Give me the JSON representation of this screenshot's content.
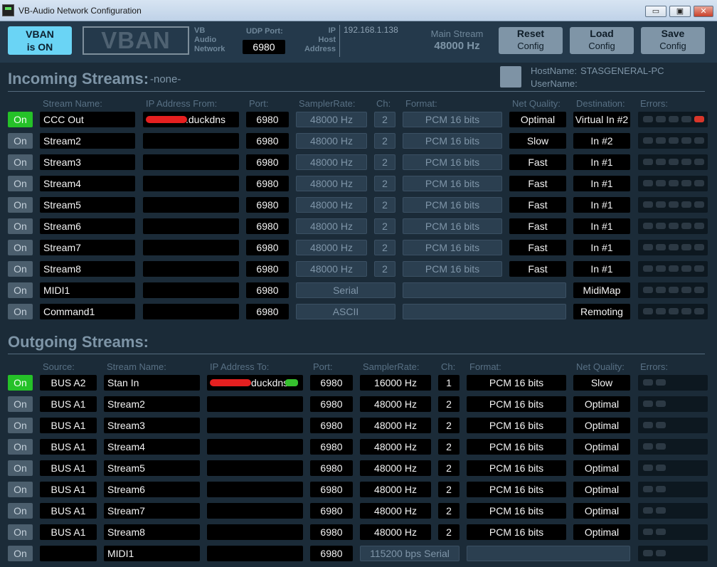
{
  "window": {
    "title": "VB-Audio Network Configuration",
    "min": "▭",
    "max": "▣",
    "close": "✕"
  },
  "header": {
    "vban_status": "VBAN\nis ON",
    "logo": "VBAN",
    "vb_small": "VB\nAudio\nNetwork",
    "udp_label": "UDP Port:",
    "udp_port": "6980",
    "ip_label": "IP\nHost\nAddress",
    "ip": "192.168.1.138",
    "main_stream_label": "Main Stream",
    "main_stream_rate": "48000 Hz",
    "reset_l1": "Reset",
    "reset_l2": "Config",
    "load_l1": "Load",
    "load_l2": "Config",
    "save_l1": "Save",
    "save_l2": "Config"
  },
  "incoming": {
    "title": "Incoming Streams:",
    "none": "-none-",
    "hostname_label": "HostName:",
    "hostname": "STASGENERAL-PC",
    "username_label": "UserName:",
    "columns": {
      "name": "Stream Name:",
      "ip": "IP Address From:",
      "port": "Port:",
      "rate": "SamplerRate:",
      "ch": "Ch:",
      "format": "Format:",
      "quality": "Net Quality:",
      "dest": "Destination:",
      "errors": "Errors:"
    },
    "on_label": "On",
    "rows": [
      {
        "active": true,
        "name": "CCC Out",
        "ip": ".duckdns",
        "port": "6980",
        "rate": "48000 Hz",
        "ch": "2",
        "format": "PCM 16 bits",
        "quality": "Optimal",
        "dest": "Virtual In #2",
        "error_led": true
      },
      {
        "active": false,
        "name": "Stream2",
        "ip": "",
        "port": "6980",
        "rate": "48000 Hz",
        "ch": "2",
        "format": "PCM 16 bits",
        "quality": "Slow",
        "dest": "In #2",
        "error_led": false
      },
      {
        "active": false,
        "name": "Stream3",
        "ip": "",
        "port": "6980",
        "rate": "48000 Hz",
        "ch": "2",
        "format": "PCM 16 bits",
        "quality": "Fast",
        "dest": "In #1",
        "error_led": false
      },
      {
        "active": false,
        "name": "Stream4",
        "ip": "",
        "port": "6980",
        "rate": "48000 Hz",
        "ch": "2",
        "format": "PCM 16 bits",
        "quality": "Fast",
        "dest": "In #1",
        "error_led": false
      },
      {
        "active": false,
        "name": "Stream5",
        "ip": "",
        "port": "6980",
        "rate": "48000 Hz",
        "ch": "2",
        "format": "PCM 16 bits",
        "quality": "Fast",
        "dest": "In #1",
        "error_led": false
      },
      {
        "active": false,
        "name": "Stream6",
        "ip": "",
        "port": "6980",
        "rate": "48000 Hz",
        "ch": "2",
        "format": "PCM 16 bits",
        "quality": "Fast",
        "dest": "In #1",
        "error_led": false
      },
      {
        "active": false,
        "name": "Stream7",
        "ip": "",
        "port": "6980",
        "rate": "48000 Hz",
        "ch": "2",
        "format": "PCM 16 bits",
        "quality": "Fast",
        "dest": "In #1",
        "error_led": false
      },
      {
        "active": false,
        "name": "Stream8",
        "ip": "",
        "port": "6980",
        "rate": "48000 Hz",
        "ch": "2",
        "format": "PCM 16 bits",
        "quality": "Fast",
        "dest": "In #1",
        "error_led": false
      },
      {
        "active": false,
        "name": "MIDI1",
        "ip": "",
        "port": "6980",
        "rate": "Serial",
        "ch": "",
        "format": "",
        "quality": "",
        "dest": "MidiMap",
        "error_led": false
      },
      {
        "active": false,
        "name": "Command1",
        "ip": "",
        "port": "6980",
        "rate": "ASCII",
        "ch": "",
        "format": "",
        "quality": "",
        "dest": "Remoting",
        "error_led": false
      }
    ]
  },
  "outgoing": {
    "title": "Outgoing Streams:",
    "columns": {
      "source": "Source:",
      "name": "Stream Name:",
      "ip": "IP Address To:",
      "port": "Port:",
      "rate": "SamplerRate:",
      "ch": "Ch:",
      "format": "Format:",
      "quality": "Net Quality:",
      "errors": "Errors:"
    },
    "on_label": "On",
    "rows": [
      {
        "active": true,
        "source": "BUS A2",
        "name": "Stan In",
        "ip": "duckdns",
        "port": "6980",
        "rate": "16000 Hz",
        "ch": "1",
        "format": "PCM 16 bits",
        "quality": "Slow"
      },
      {
        "active": false,
        "source": "BUS A1",
        "name": "Stream2",
        "ip": "",
        "port": "6980",
        "rate": "48000 Hz",
        "ch": "2",
        "format": "PCM 16 bits",
        "quality": "Optimal"
      },
      {
        "active": false,
        "source": "BUS A1",
        "name": "Stream3",
        "ip": "",
        "port": "6980",
        "rate": "48000 Hz",
        "ch": "2",
        "format": "PCM 16 bits",
        "quality": "Optimal"
      },
      {
        "active": false,
        "source": "BUS A1",
        "name": "Stream4",
        "ip": "",
        "port": "6980",
        "rate": "48000 Hz",
        "ch": "2",
        "format": "PCM 16 bits",
        "quality": "Optimal"
      },
      {
        "active": false,
        "source": "BUS A1",
        "name": "Stream5",
        "ip": "",
        "port": "6980",
        "rate": "48000 Hz",
        "ch": "2",
        "format": "PCM 16 bits",
        "quality": "Optimal"
      },
      {
        "active": false,
        "source": "BUS A1",
        "name": "Stream6",
        "ip": "",
        "port": "6980",
        "rate": "48000 Hz",
        "ch": "2",
        "format": "PCM 16 bits",
        "quality": "Optimal"
      },
      {
        "active": false,
        "source": "BUS A1",
        "name": "Stream7",
        "ip": "",
        "port": "6980",
        "rate": "48000 Hz",
        "ch": "2",
        "format": "PCM 16 bits",
        "quality": "Optimal"
      },
      {
        "active": false,
        "source": "BUS A1",
        "name": "Stream8",
        "ip": "",
        "port": "6980",
        "rate": "48000 Hz",
        "ch": "2",
        "format": "PCM 16 bits",
        "quality": "Optimal"
      },
      {
        "active": false,
        "source": "",
        "name": "MIDI1",
        "ip": "",
        "port": "6980",
        "rate": "115200 bps Serial",
        "ch": "",
        "format": "",
        "quality": ""
      }
    ]
  }
}
